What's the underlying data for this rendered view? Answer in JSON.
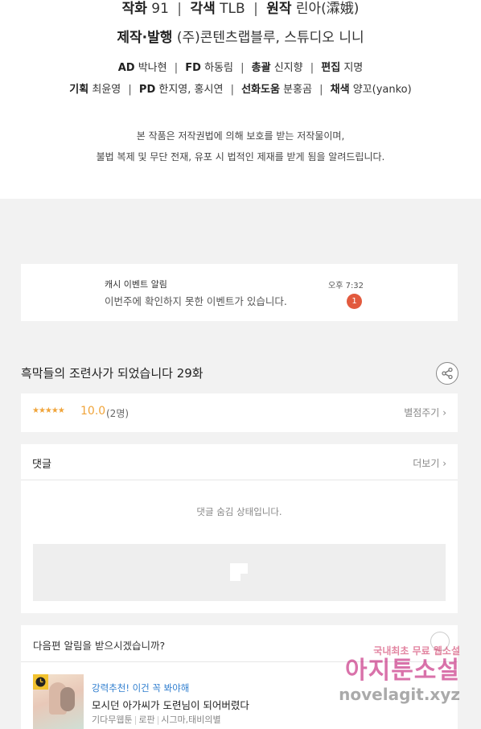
{
  "credits": {
    "line1": [
      {
        "label": "작화",
        "value": "91"
      },
      {
        "label": "각색",
        "value": "TLB"
      },
      {
        "label": "원작",
        "value": "린아(瀮娥)"
      }
    ],
    "line2": {
      "label": "제작·발행",
      "value": "(주)콘텐츠랩블루, 스튜디오 니니"
    },
    "line3": [
      {
        "label": "AD",
        "value": "박나현"
      },
      {
        "label": "FD",
        "value": "하동림"
      },
      {
        "label": "총괄",
        "value": "신지향"
      },
      {
        "label": "편집",
        "value": "지명"
      }
    ],
    "line4": [
      {
        "label": "기획",
        "value": "최윤영"
      },
      {
        "label": "PD",
        "value": "한지영, 홍시연"
      },
      {
        "label": "선화도움",
        "value": "분홍곰"
      },
      {
        "label": "채색",
        "value": "양꼬(yanko)"
      }
    ],
    "notice1": "본 작품은 저작권법에 의해 보호를 받는 저작물이며,",
    "notice2": "불법 복제 및 무단 전재, 유포 시 법적인 제재를 받게 됨을 알려드립니다."
  },
  "cash_event": {
    "title": "캐시 이벤트 알림",
    "message": "이번주에 확인하지 못한 이벤트가 있습니다.",
    "time": "오후 7:32",
    "badge": "1"
  },
  "episode": {
    "title": "흑막들의 조련사가 되었습니다 29화",
    "share_icon": "share-icon"
  },
  "rating": {
    "stars": "★★★★★",
    "score": "10.0",
    "count": "(2명)",
    "rate_link": "별점주기"
  },
  "comments": {
    "title": "댓글",
    "more": "더보기",
    "hidden_message": "댓글 숨김 상태입니다."
  },
  "next_episode": {
    "question": "다음편 알림을 받으시겠습니까?",
    "recommend": {
      "tag": "강력추천! 이건 꼭 봐야해",
      "title": "모시던 아가씨가 도련님이 되어버렸다",
      "meta": [
        "기다무웹툰",
        "로판",
        "시그마,태비의별"
      ]
    }
  },
  "watermark": {
    "line1": "국내최초 무료 웹소설",
    "line2": "아지툰소설",
    "line3": "novelagit.xyz"
  },
  "colors": {
    "accent_orange": "#f0a43a",
    "badge_red": "#e25a3e",
    "link_blue": "#2f7ecf",
    "background": "#f2f2f2"
  }
}
